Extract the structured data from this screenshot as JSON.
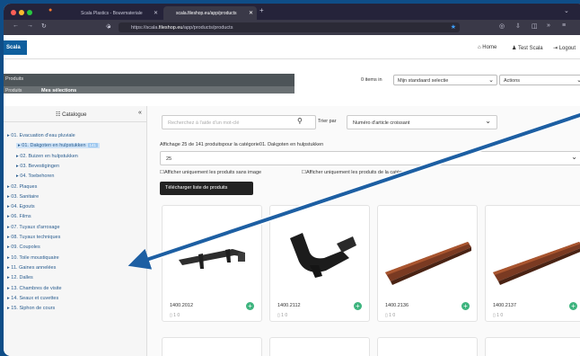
{
  "browser": {
    "tabs": [
      {
        "label": "Scala Plastics - Bouwmateriale"
      },
      {
        "label": "scala.fileshop.eu/app/products"
      }
    ],
    "url_prefix": "https://scala.",
    "url_domain": "fileshop.eu",
    "url_path": "/app/products/products"
  },
  "app": {
    "logo": "Scala",
    "nav": {
      "home": "Home",
      "user": "Test Scala",
      "logout": "Logout"
    }
  },
  "breadcrumb": {
    "products": "Produits",
    "selections": "Mes sélections"
  },
  "toolbar": {
    "items_count": "0 items in",
    "selection": "Mijn standaard selectie",
    "actions": "Actions"
  },
  "sidebar": {
    "title": "Catalogue",
    "collapse_icon": "«",
    "items": [
      {
        "label": "01. Evacuation d'eau pluviale",
        "level": 0
      },
      {
        "label": "01. Dakgoten en hulpstukken",
        "level": 1,
        "badge": "141"
      },
      {
        "label": "02. Buizen en hulpstukken",
        "level": 1
      },
      {
        "label": "03. Bevestigingen",
        "level": 1
      },
      {
        "label": "04. Toebehoren",
        "level": 1
      },
      {
        "label": "02. Plaques",
        "level": 0
      },
      {
        "label": "03. Sanitaire",
        "level": 0
      },
      {
        "label": "04. Egouts",
        "level": 0
      },
      {
        "label": "06. Films",
        "level": 0
      },
      {
        "label": "07. Tuyaux d'arrosage",
        "level": 0
      },
      {
        "label": "08. Tuyaux techniques",
        "level": 0
      },
      {
        "label": "09. Coupoles",
        "level": 0
      },
      {
        "label": "10. Toile moustiquaire",
        "level": 0
      },
      {
        "label": "11. Gaines annelées",
        "level": 0
      },
      {
        "label": "12. Dalles",
        "level": 0
      },
      {
        "label": "13. Chambres de visite",
        "level": 0
      },
      {
        "label": "14. Seaux et cuvettes",
        "level": 0
      },
      {
        "label": "15. Siphon de cours",
        "level": 0
      }
    ]
  },
  "main": {
    "search_placeholder": "Recherchez à l'aide d'un mot-clé",
    "sort_label": "Trier par",
    "sort_value": "Numéro d'article croissant",
    "summary": "Affichage 25 de 141 produitspour la catégorie01. Dakgoten en hulpstukken",
    "per_page": "25",
    "checkbox_no_image": "Afficher uniquement les produits sans image",
    "checkbox_category": "Afficher uniquement les produits de la catégorie",
    "download_button": "Télécharger liste de produits",
    "products": [
      {
        "code": "1400.2012",
        "meta": "1  0"
      },
      {
        "code": "1400.2112",
        "meta": "1  0"
      },
      {
        "code": "1400.2136",
        "meta": "1  0"
      },
      {
        "code": "1400.2137",
        "meta": "1  0"
      }
    ]
  },
  "colors": {
    "accent": "#0f5f9e",
    "add_button": "#3db47e",
    "arrow": "#1d5fa3",
    "frame": "#0f4d87"
  }
}
